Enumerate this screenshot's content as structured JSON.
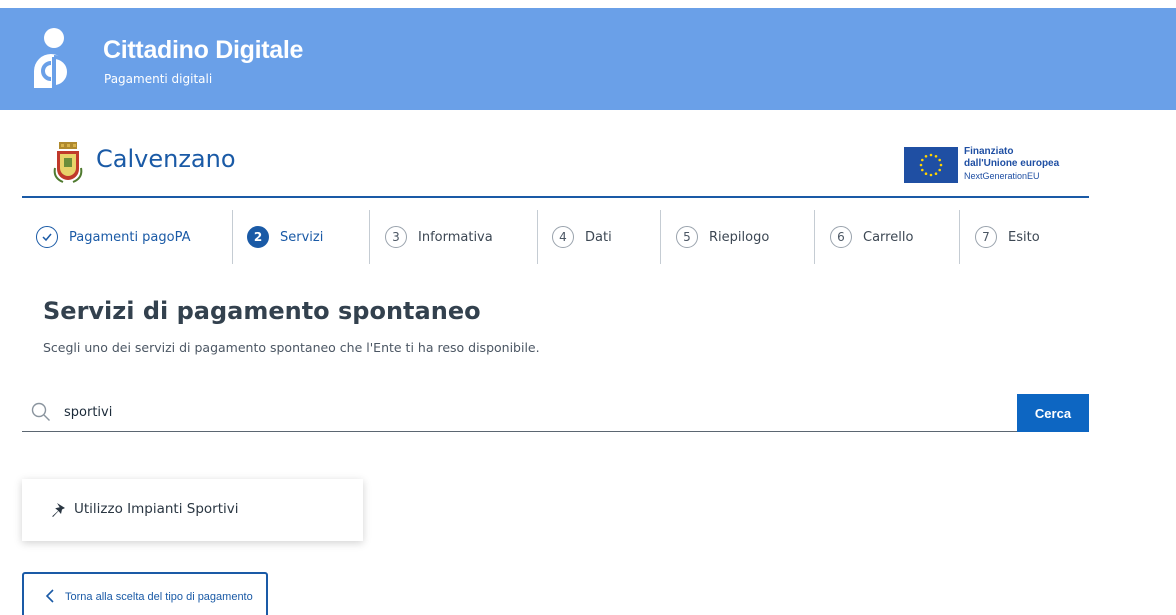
{
  "header": {
    "title": "Cittadino Digitale",
    "subtitle": "Pagamenti digitali",
    "logo_icon": "cittadino-digitale-logo-icon",
    "color": "#6aa0e8"
  },
  "entity": {
    "name": "Calvenzano",
    "crest_icon": "municipal-crest-icon",
    "eu_badge": {
      "line1": "Finanziato",
      "line2": "dall'Unione europea",
      "line3": "NextGenerationEU",
      "flag_icon": "eu-flag-icon"
    }
  },
  "steps": [
    {
      "num": "",
      "label": "Pagamenti pagoPA",
      "state": "done",
      "icon": "check-icon"
    },
    {
      "num": "2",
      "label": "Servizi",
      "state": "active"
    },
    {
      "num": "3",
      "label": "Informativa",
      "state": "todo"
    },
    {
      "num": "4",
      "label": "Dati",
      "state": "todo"
    },
    {
      "num": "5",
      "label": "Riepilogo",
      "state": "todo"
    },
    {
      "num": "6",
      "label": "Carrello",
      "state": "todo"
    },
    {
      "num": "7",
      "label": "Esito",
      "state": "todo"
    }
  ],
  "main": {
    "title": "Servizi di pagamento spontaneo",
    "description": "Scegli uno dei servizi di pagamento spontaneo che l'Ente ti ha reso disponibile."
  },
  "search": {
    "value": "sportivi",
    "button_label": "Cerca",
    "icon": "search-icon"
  },
  "results": [
    {
      "label": "Utilizzo Impianti Sportivi",
      "icon": "pin-icon"
    }
  ],
  "back_button": {
    "label": "Torna alla scelta del tipo di pagamento",
    "icon": "chevron-left-icon"
  },
  "colors": {
    "primary": "#1a5aa6",
    "button": "#0d66c2"
  }
}
